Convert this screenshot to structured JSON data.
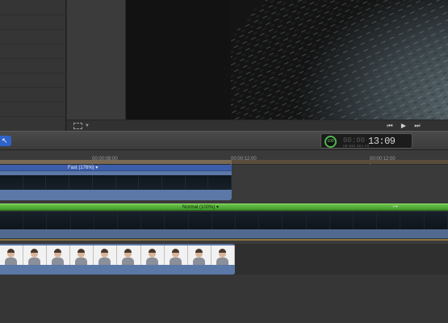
{
  "viewer": {
    "transform_label": "⬚",
    "playback": {
      "prev_label": "⏮",
      "play_label": "▶",
      "next_label": "⏭"
    }
  },
  "toolbar": {
    "tool_label": "↖",
    "dashboard": {
      "speed_label": "100",
      "timecode_ghost": "00:00",
      "timecode": "13:09",
      "units": "HR MIN SEC FR"
    }
  },
  "ruler": {
    "labels": [
      "00:00:08:00",
      "00:00:12:00",
      "00:00:12:00"
    ]
  },
  "timeline": {
    "fast_clip": {
      "label": "Fast (176%) ▾"
    },
    "normal_clip": {
      "label": "Normal (100%) ▾",
      "handle_label": "↦"
    }
  },
  "colors": {
    "retime_green": "#5fb53a",
    "clip_blue": "#5b78a7",
    "retime_blue": "#3d5eaa"
  }
}
